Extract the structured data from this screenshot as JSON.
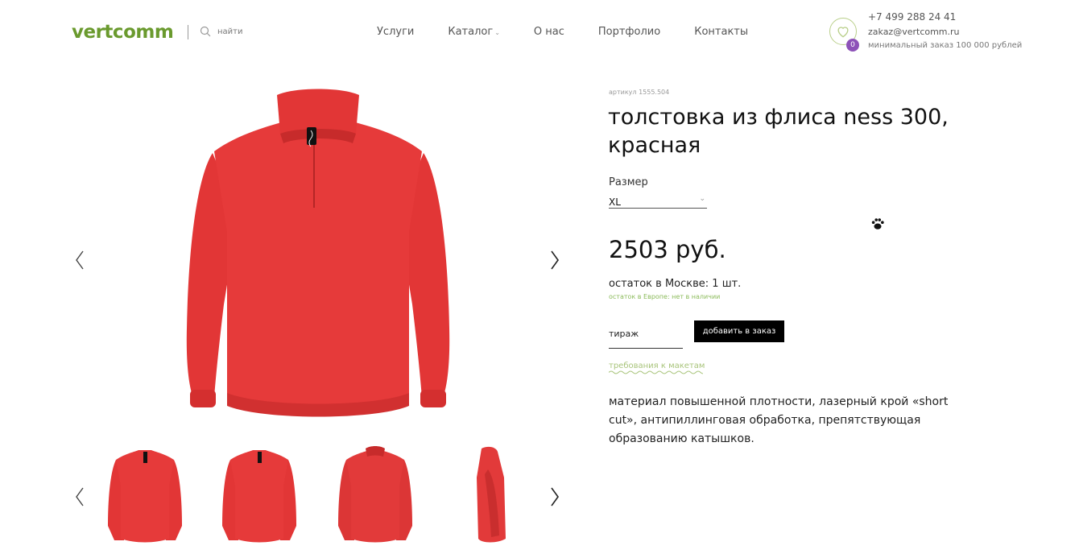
{
  "header": {
    "logo": "vertcomm",
    "search_label": "найти",
    "nav": [
      {
        "label": "Услуги"
      },
      {
        "label": "Каталог",
        "caret": "⌄"
      },
      {
        "label": "О нас"
      },
      {
        "label": "Портфолио"
      },
      {
        "label": "Контакты"
      }
    ],
    "favorites_count": "0",
    "phone": "+7 499 288 24 41",
    "email": "zakaz@vertcomm.ru",
    "min_order": "минимальный заказ 100 000 рублей"
  },
  "product": {
    "article": "артикул 1555.504",
    "title": "толстовка из флиса ness 300, красная",
    "size_label": "Размер",
    "size_value": "XL",
    "price": "2503 руб.",
    "stock_moscow": "остаток в Москве: 1 шт.",
    "stock_europe": "остаток в Европе: нет в наличии",
    "qty_placeholder": "тираж",
    "add_button": "добавить в заказ",
    "requirements_link": "требования к макетам",
    "description": "материал повышенной плотности, лазерный крой «short cut», антипиллинговая обработка, препятствующая образованию катышков."
  },
  "colors": {
    "brand_green": "#6a9a2e",
    "garment_red": "#e63a3a",
    "badge_purple": "#8d52b8",
    "link_green": "#a8c47a"
  },
  "icons": [
    "search-icon",
    "heart-icon",
    "paw-icon",
    "chevron-left-icon",
    "chevron-right-icon"
  ]
}
